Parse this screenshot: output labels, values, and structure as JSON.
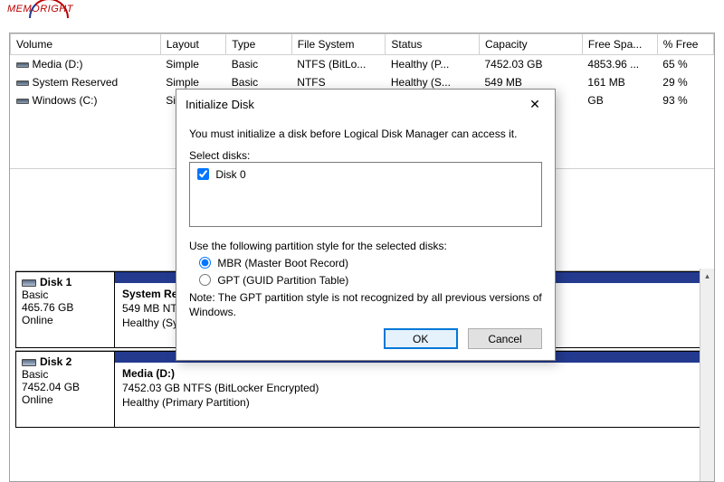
{
  "brand": "MEMORIGHT",
  "columns": {
    "volume": "Volume",
    "layout": "Layout",
    "type": "Type",
    "filesystem": "File System",
    "status": "Status",
    "capacity": "Capacity",
    "freespace": "Free Spa...",
    "pctfree": "% Free"
  },
  "volumes": [
    {
      "name": "Media (D:)",
      "layout": "Simple",
      "type": "Basic",
      "fs": "NTFS (BitLo...",
      "status": "Healthy (P...",
      "capacity": "7452.03 GB",
      "free": "4853.96 ...",
      "pct": "65 %"
    },
    {
      "name": "System Reserved",
      "layout": "Simple",
      "type": "Basic",
      "fs": "NTFS",
      "status": "Healthy (S...",
      "capacity": "549 MB",
      "free": "161 MB",
      "pct": "29 %"
    },
    {
      "name": "Windows (C:)",
      "layout": "Simple",
      "type": "",
      "fs": "",
      "status": "",
      "capacity": "",
      "free": "GB",
      "pct": "93 %"
    }
  ],
  "disks": [
    {
      "title": "Disk 1",
      "kind": "Basic",
      "size": "465.76 GB",
      "state": "Online",
      "part_title": "System Re",
      "part_line1": "549 MB NT",
      "part_line2": "Healthy (Sy"
    },
    {
      "title": "Disk 2",
      "kind": "Basic",
      "size": "7452.04 GB",
      "state": "Online",
      "part_title": "Media  (D:)",
      "part_line1": "7452.03 GB NTFS (BitLocker Encrypted)",
      "part_line2": "Healthy (Primary Partition)"
    }
  ],
  "dialog": {
    "title": "Initialize Disk",
    "close": "✕",
    "intro": "You must initialize a disk before Logical Disk Manager can access it.",
    "select_label": "Select disks:",
    "disk_option": "Disk 0",
    "style_label": "Use the following partition style for the selected disks:",
    "mbr": "MBR (Master Boot Record)",
    "gpt": "GPT (GUID Partition Table)",
    "note": "Note: The GPT partition style is not recognized by all previous versions of Windows.",
    "ok": "OK",
    "cancel": "Cancel"
  }
}
